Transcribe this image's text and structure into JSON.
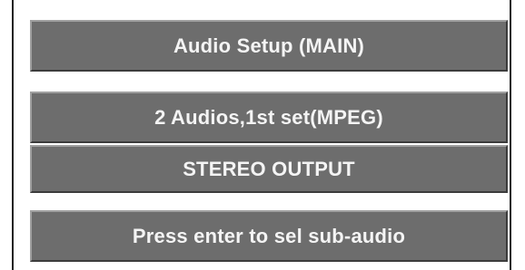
{
  "menu": {
    "title": "Audio Setup (MAIN)",
    "audio_info": "2 Audios,1st set(MPEG)",
    "output_mode": "STEREO OUTPUT",
    "hint": "Press enter to sel sub-audio"
  },
  "colors": {
    "bar_fill": "#6d6d6d",
    "bar_text": "#f4f4f4",
    "frame_border": "#1f1f1f",
    "background": "#ffffff"
  }
}
